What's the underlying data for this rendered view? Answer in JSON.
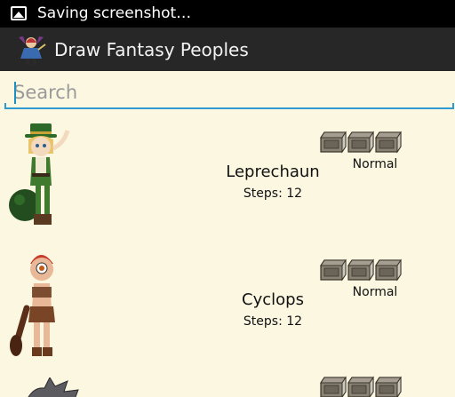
{
  "status_bar": {
    "notification_text": "Saving screenshot…"
  },
  "action_bar": {
    "title": "Draw Fantasy Peoples"
  },
  "search": {
    "placeholder": "Search",
    "value": ""
  },
  "characters": [
    {
      "name": "Leprechaun",
      "steps": "Steps: 12",
      "difficulty": "Normal"
    },
    {
      "name": "Cyclops",
      "steps": "Steps: 12",
      "difficulty": "Normal"
    }
  ],
  "icons": {
    "notification": "image-icon",
    "app": "fantasy-character-icon",
    "difficulty": "book-icon"
  },
  "colors": {
    "status_bar": "#000000",
    "action_bar": "#272727",
    "background": "#fbf7e0",
    "search_accent": "#2f9ad0"
  }
}
